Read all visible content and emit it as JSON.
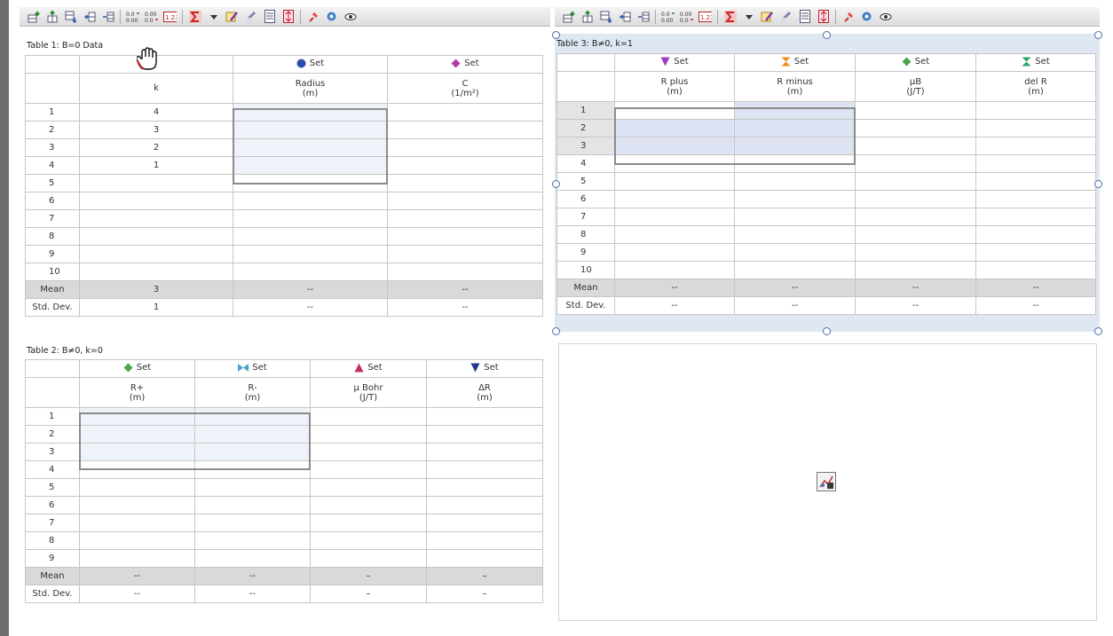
{
  "table1": {
    "title": "Table 1: B=0 Data",
    "set_headers": [
      "",
      "Set",
      "Set"
    ],
    "col_headers": [
      "k",
      "Radius\n(m)",
      "C\n(1/m²)"
    ],
    "rows": [
      [
        "1",
        "4",
        "",
        ""
      ],
      [
        "2",
        "3",
        "",
        ""
      ],
      [
        "3",
        "2",
        "",
        ""
      ],
      [
        "4",
        "1",
        "",
        ""
      ],
      [
        "5",
        "",
        "",
        ""
      ],
      [
        "6",
        "",
        "",
        ""
      ],
      [
        "7",
        "",
        "",
        ""
      ],
      [
        "8",
        "",
        "",
        ""
      ],
      [
        "9",
        "",
        "",
        ""
      ],
      [
        "10",
        "",
        "",
        ""
      ]
    ],
    "mean": [
      "Mean",
      "3",
      "--",
      "--"
    ],
    "std": [
      "Std. Dev.",
      "1",
      "--",
      "--"
    ]
  },
  "table2": {
    "title": "Table 2: B≠0, k=0",
    "set_headers": [
      "Set",
      "Set",
      "Set",
      "Set"
    ],
    "col_headers": [
      "R+\n(m)",
      "R-\n(m)",
      "μ Bohr\n(J/T)",
      "ΔR\n(m)"
    ],
    "rows": [
      [
        "1"
      ],
      [
        "2"
      ],
      [
        "3"
      ],
      [
        "4"
      ],
      [
        "5"
      ],
      [
        "6"
      ],
      [
        "7"
      ],
      [
        "8"
      ],
      [
        "9"
      ]
    ],
    "mean": [
      "Mean",
      "--",
      "--",
      "–",
      "–"
    ],
    "std": [
      "Std. Dev.",
      "--",
      "--",
      "–",
      "–"
    ]
  },
  "table3": {
    "title": "Table 3: B≠0, k=1",
    "set_headers": [
      "Set",
      "Set",
      "Set",
      "Set"
    ],
    "col_headers": [
      "R plus\n(m)",
      "R minus\n(m)",
      "μB\n(J/T)",
      "del R\n(m)"
    ],
    "rows": [
      [
        "1"
      ],
      [
        "2"
      ],
      [
        "3"
      ],
      [
        "4"
      ],
      [
        "5"
      ],
      [
        "6"
      ],
      [
        "7"
      ],
      [
        "8"
      ],
      [
        "9"
      ],
      [
        "10"
      ]
    ],
    "mean": [
      "Mean",
      "--",
      "--",
      "--",
      "--"
    ],
    "std": [
      "Std. Dev.",
      "--",
      "--",
      "--",
      "--"
    ]
  },
  "colors": {
    "blue": "#2a4dab",
    "magenta": "#b03da6",
    "green": "#4aa64a",
    "cyan": "#42a7c9",
    "red": "#c2325a",
    "navy": "#1f3a8a",
    "orange": "#f08c1a",
    "purple": "#a03cc4"
  }
}
